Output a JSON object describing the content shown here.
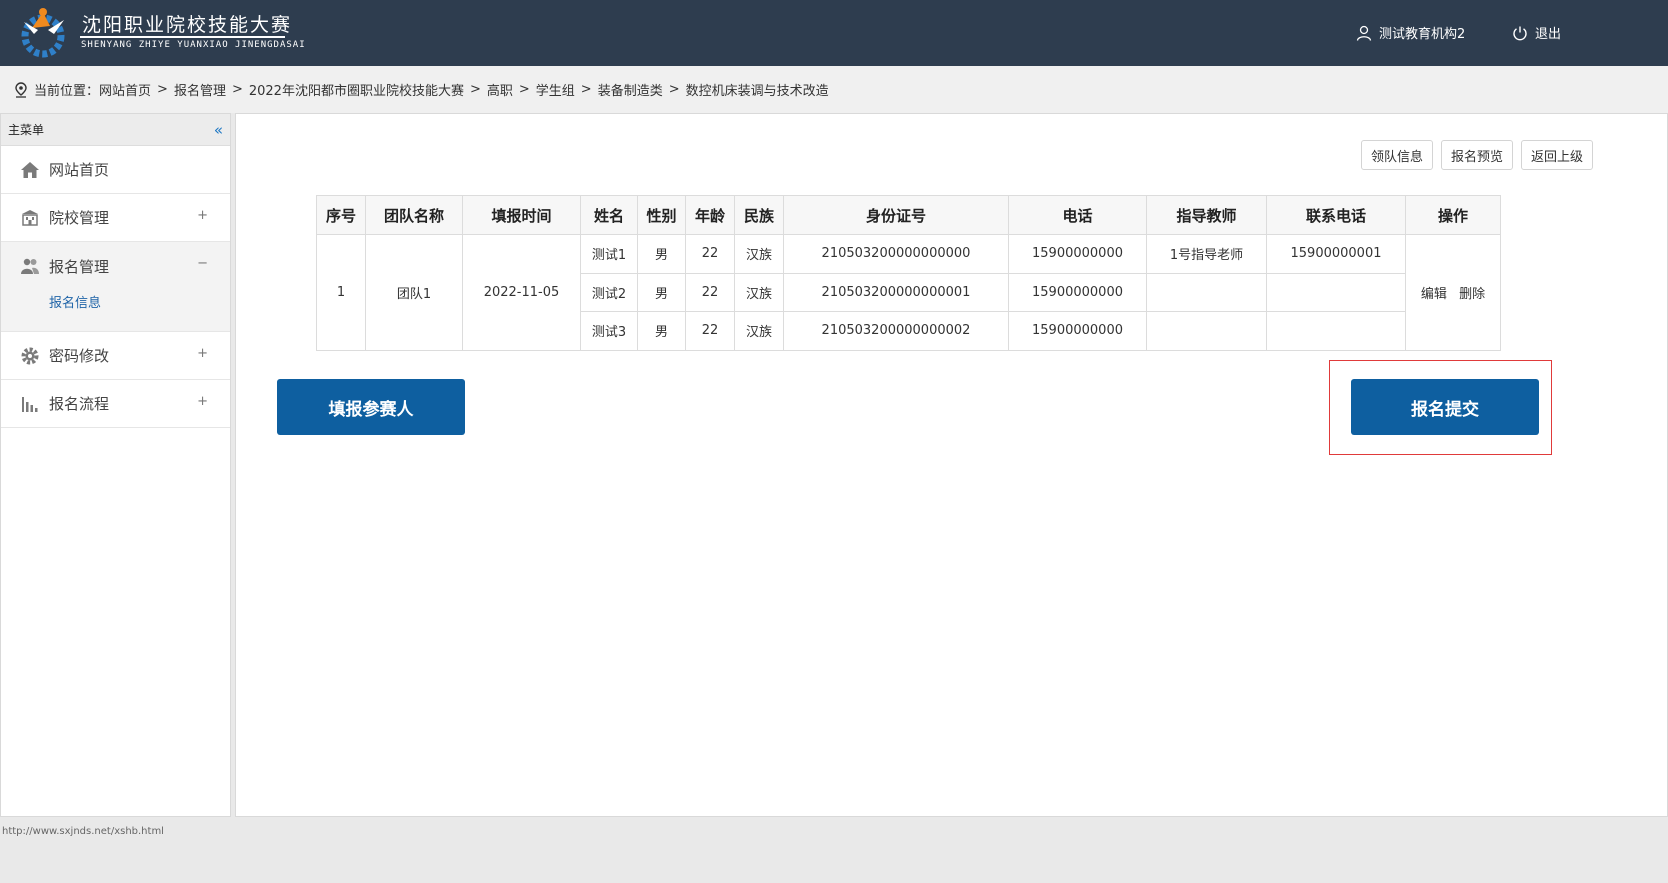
{
  "header": {
    "brand_cn": "沈阳职业院校技能大赛",
    "brand_en": "SHENYANG ZHIYE YUANXIAO JINENGDASAI",
    "user_name": "测试教育机构2",
    "logout_label": "退出",
    "colors": {
      "background": "#2e3d4f",
      "logo_orange": "#f08a1f",
      "logo_blue": "#2f80c9"
    }
  },
  "breadcrumb": {
    "prefix": "当前位置：",
    "items": [
      "网站首页",
      "报名管理",
      "2022年沈阳都市圈职业院校技能大赛",
      "高职",
      "学生组",
      "装备制造类",
      "数控机床装调与技术改造"
    ],
    "separator": ">"
  },
  "sidebar": {
    "title": "主菜单",
    "collapse_icon": "«",
    "items": [
      {
        "label": "网站首页",
        "icon": "home-icon",
        "sign": ""
      },
      {
        "label": "院校管理",
        "icon": "school-icon",
        "sign": "+"
      },
      {
        "label": "报名管理",
        "icon": "users-icon",
        "sign": "−",
        "expanded": true,
        "children": [
          "报名信息"
        ]
      },
      {
        "label": "密码修改",
        "icon": "gear-icon",
        "sign": "+"
      },
      {
        "label": "报名流程",
        "icon": "bar-chart-icon",
        "sign": "+"
      }
    ]
  },
  "toolbar": {
    "leader_info": "领队信息",
    "preview": "报名预览",
    "back": "返回上级"
  },
  "table": {
    "headers": [
      "序号",
      "团队名称",
      "填报时间",
      "姓名",
      "性别",
      "年龄",
      "民族",
      "身份证号",
      "电话",
      "指导教师",
      "联系电话",
      "操作"
    ],
    "team": {
      "index": "1",
      "name": "团队1",
      "date": "2022-11-05"
    },
    "members": [
      {
        "name": "测试1",
        "gender": "男",
        "age": "22",
        "ethnicity": "汉族",
        "id_number": "210503200000000000",
        "phone": "15900000000",
        "teacher": "1号指导老师",
        "contact": "15900000001"
      },
      {
        "name": "测试2",
        "gender": "男",
        "age": "22",
        "ethnicity": "汉族",
        "id_number": "210503200000000001",
        "phone": "15900000000",
        "teacher": "",
        "contact": ""
      },
      {
        "name": "测试3",
        "gender": "男",
        "age": "22",
        "ethnicity": "汉族",
        "id_number": "210503200000000002",
        "phone": "15900000000",
        "teacher": "",
        "contact": ""
      }
    ],
    "ops": {
      "edit": "编辑",
      "delete": "删除"
    }
  },
  "actions": {
    "add_participant": "填报参赛人",
    "submit": "报名提交",
    "button_color": "#0e5fa0",
    "highlight_color": "#e03a3a"
  },
  "statusbar": {
    "text": "http://www.sxjnds.net/xshb.html"
  }
}
